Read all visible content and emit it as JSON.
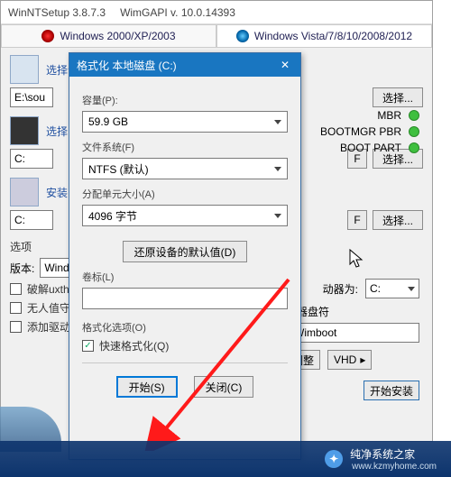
{
  "main_window": {
    "title": "WinNTSetup 3.8.7.3",
    "api_label": "WimGAPI v. 10.0.14393",
    "tabs": {
      "legacy": "Windows 2000/XP/2003",
      "modern": "Windows Vista/7/8/10/2008/2012"
    },
    "section1_label": "选择包含Windows安装文件的文件夹",
    "section1_value": "E:\\sou",
    "section2_label": "选择",
    "section2_value": "C:",
    "section3_label": "安装",
    "section3_value": "C:",
    "select_btn": "选择...",
    "f_btn": "F",
    "status": {
      "mbr": "MBR",
      "bootmgr": "BOOTMGR PBR",
      "bootpart": "BOOT PART"
    },
    "options_label": "选项",
    "version_label": "版本:",
    "version_value": "Wind",
    "chk_crack": "破解uxthe",
    "chk_unattend": "无人值守",
    "chk_adddriver": "添加驱动",
    "mount_label": "动器为:",
    "mount_value": "C:",
    "wimboot_label": "驱动器盘符",
    "wimboot_value": "Wimboot",
    "tweak_btn": "化调整",
    "vhd_btn": "VHD",
    "start_install": "开始安装"
  },
  "dialog": {
    "title": "格式化 本地磁盘 (C:)",
    "capacity_label": "容量(P):",
    "capacity_value": "59.9 GB",
    "fs_label": "文件系统(F)",
    "fs_value": "NTFS (默认)",
    "alloc_label": "分配单元大小(A)",
    "alloc_value": "4096 字节",
    "restore_btn": "还原设备的默认值(D)",
    "volume_label": "卷标(L)",
    "volume_value": "",
    "format_opts_label": "格式化选项(O)",
    "quick_format": "快速格式化(Q)",
    "start_btn": "开始(S)",
    "close_btn": "关闭(C)"
  },
  "watermark": {
    "text": "纯净系统之家",
    "sub": "www.kzmyhome.com"
  }
}
